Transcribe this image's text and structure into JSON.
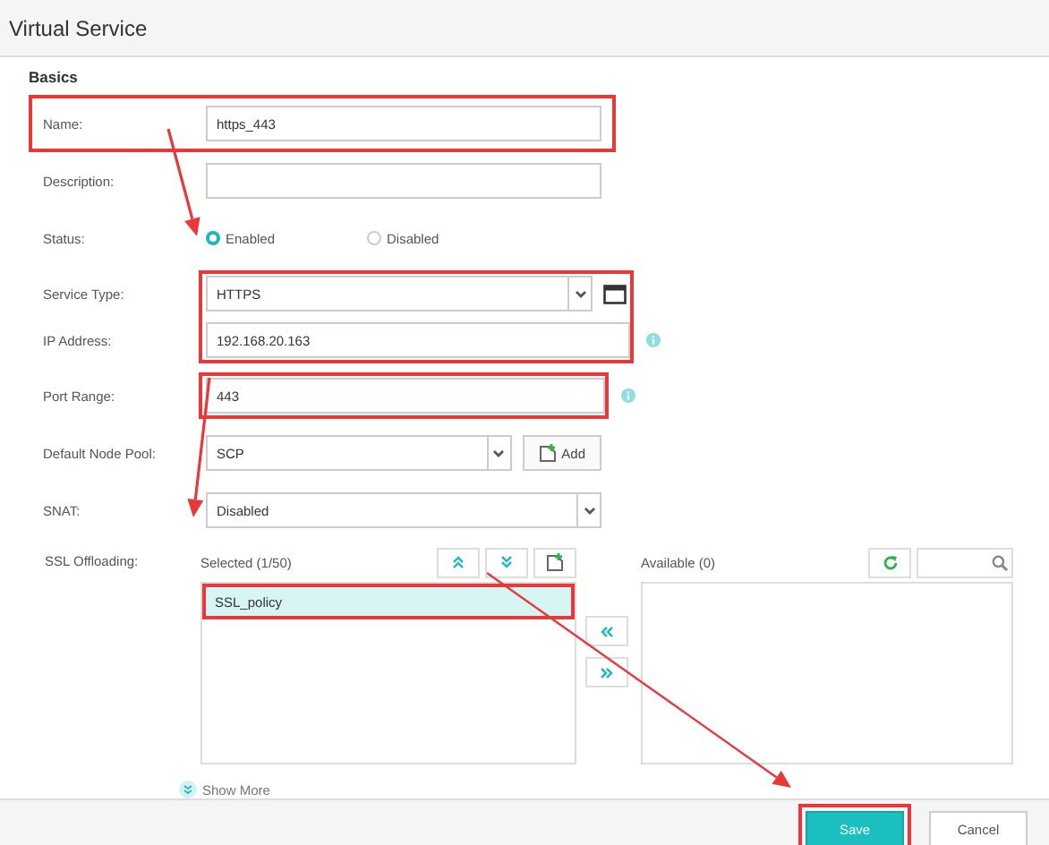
{
  "window": {
    "title": "Virtual Service"
  },
  "section": "Basics",
  "rows": [
    {
      "kind": "text",
      "label": "Name:",
      "value": "https_443",
      "highlighted": true,
      "field_highlighted": false
    },
    {
      "kind": "text",
      "label": "Description:",
      "highlighted": false,
      "field_highlighted": false
    },
    {
      "kind": "radio",
      "label": "Status:",
      "highlighted": false,
      "field_highlighted": false,
      "options": [
        {
          "label": "Enabled",
          "selected": true
        },
        {
          "label": "Disabled",
          "selected": false
        }
      ]
    },
    {
      "kind": "group",
      "field_highlighted": true,
      "rows": [
        {
          "kind": "select",
          "label": "Service Type:",
          "value": "HTTPS",
          "addon": {
            "kind": "window"
          }
        },
        {
          "kind": "text",
          "label": "IP Address:",
          "value": "192.168.20.163",
          "addon": {
            "kind": "info"
          }
        }
      ]
    },
    {
      "kind": "text",
      "label": "Port Range:",
      "value": "443",
      "highlighted": false,
      "field_highlighted": true,
      "addon": {
        "kind": "info"
      }
    },
    {
      "kind": "select",
      "label": "Default Node Pool:",
      "value": "SCP",
      "highlighted": false,
      "field_highlighted": false,
      "addon": {
        "kind": "button",
        "label": "Add"
      }
    },
    {
      "kind": "select",
      "label": "SNAT:",
      "value": "Disabled",
      "highlighted": false,
      "field_highlighted": false
    }
  ],
  "ssl": {
    "label": "SSL Offloading:",
    "selected_panel": {
      "title": "Selected (1/50)",
      "items": [
        {
          "label": "SSL_policy",
          "selected": true,
          "highlighted": true
        }
      ]
    },
    "available_panel": {
      "title": "Available (0)"
    }
  },
  "show_more": "Show More",
  "buttons": [
    {
      "label": "Save",
      "kind": "primary",
      "highlighted": true
    },
    {
      "label": "Cancel",
      "kind": "secondary",
      "highlighted": false
    }
  ]
}
